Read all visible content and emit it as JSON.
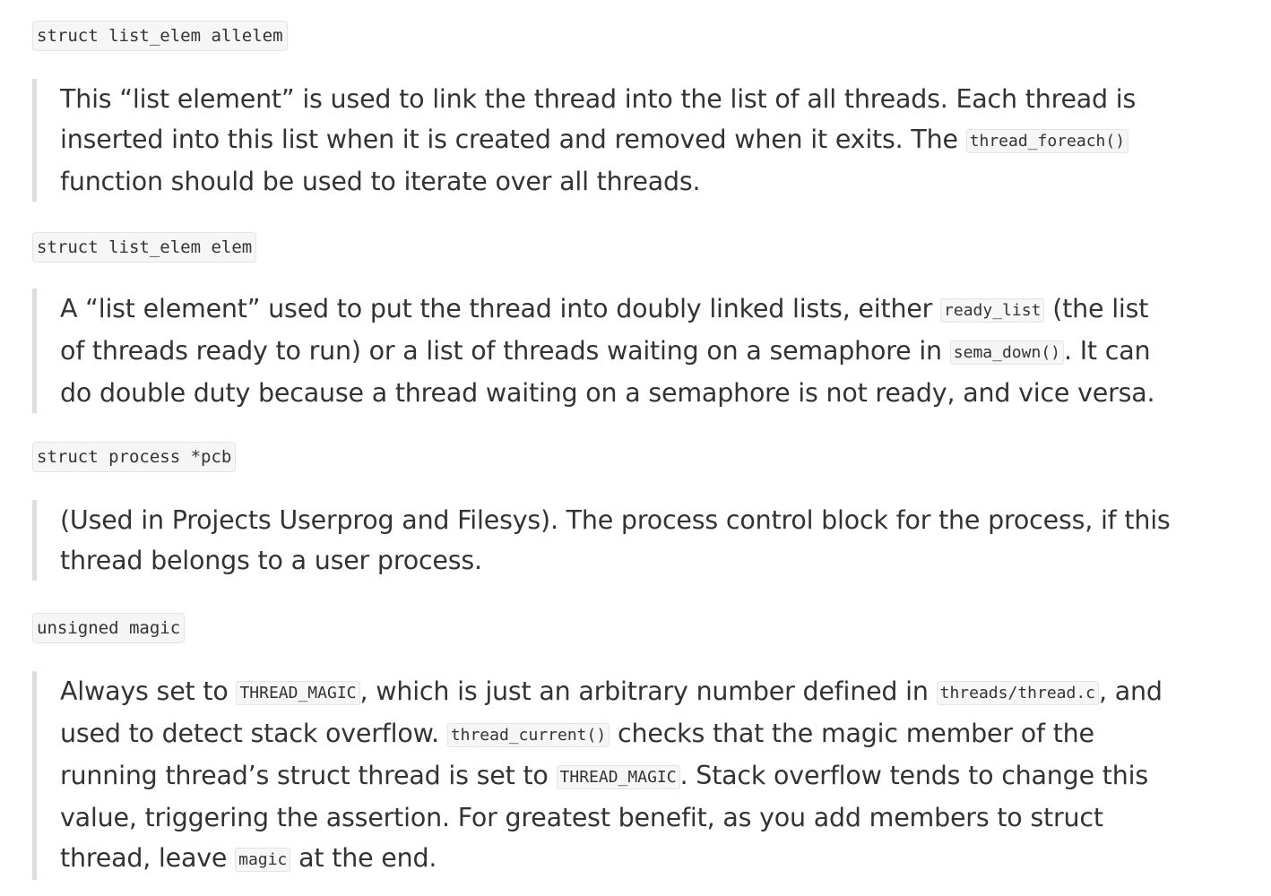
{
  "members": [
    {
      "code": "struct list_elem allelem",
      "desc": {
        "t0": "This “list element” is used to link the thread into the list of all threads. Each thread is inserted into this list when it is created and removed when it exits. The ",
        "c0": "thread_foreach()",
        "t1": " function should be used to iterate over all threads."
      }
    },
    {
      "code": "struct list_elem elem",
      "desc": {
        "t0": "A “list element” used to put the thread into doubly linked lists, either ",
        "c0": "ready_list",
        "t1": " (the list of threads ready to run) or a list of threads waiting on a semaphore in ",
        "c1": "sema_down()",
        "t2": ". It can do double duty because a thread waiting on a semaphore is not ready, and vice versa."
      }
    },
    {
      "code": "struct process *pcb",
      "desc": {
        "t0": "(Used in Projects Userprog and Filesys). The process control block for the process, if this thread belongs to a user process."
      }
    },
    {
      "code": "unsigned magic",
      "desc": {
        "t0": "Always set to ",
        "c0": "THREAD_MAGIC",
        "t1": ", which is just an arbitrary number defined in ",
        "c1": "threads/thread.c",
        "t2": ", and used to detect stack overflow. ",
        "c2": "thread_current()",
        "t3": " checks that the magic member of the running thread’s struct thread is set to ",
        "c3": "THREAD_MAGIC",
        "t4": ". Stack overflow tends to change this value, triggering the assertion. For greatest benefit, as you add members to struct thread, leave ",
        "c4": "magic",
        "t5": " at the end."
      }
    }
  ]
}
